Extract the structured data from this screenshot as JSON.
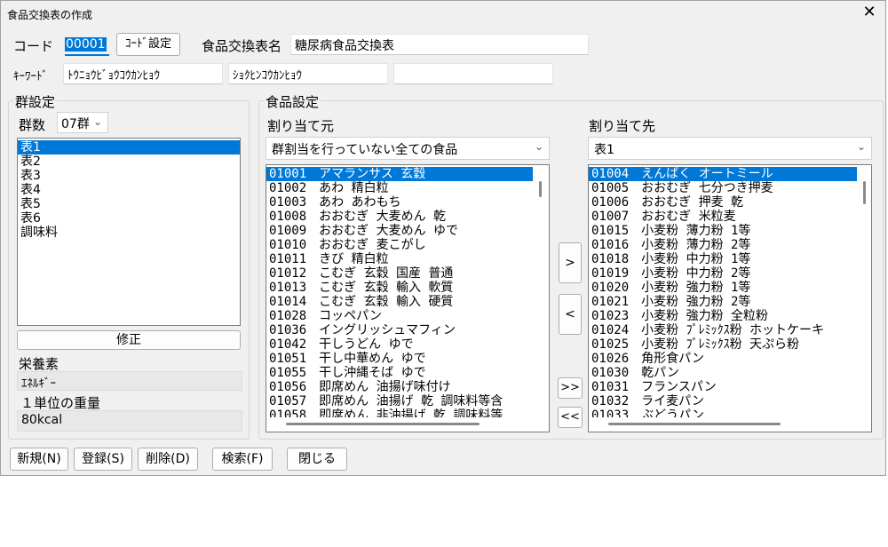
{
  "window": {
    "title": "食品交換表の作成",
    "close_glyph": "✕"
  },
  "header": {
    "code_label": "コード",
    "code_value": "00001",
    "code_settings_button": "ｺｰﾄﾞ設定",
    "table_name_label": "食品交換表名",
    "table_name_value": "糖尿病食品交換表",
    "keyword_label": "ｷｰﾜｰﾄﾞ",
    "keyword1": "ﾄｳﾆｮｳﾋﾞｮｳｺｳｶﾝﾋｮｳ",
    "keyword2": "ｼｮｸﾋﾝｺｳｶﾝﾋｮｳ",
    "keyword3": ""
  },
  "group_settings": {
    "title": "群設定",
    "count_label": "群数",
    "count_value": "07群",
    "groups": [
      "表1",
      "表2",
      "表3",
      "表4",
      "表5",
      "表6",
      "調味料"
    ],
    "selected_index": 0,
    "modify_button": "修正",
    "nutrient_label": "栄養素",
    "nutrient_value": "ｴﾈﾙｷﾞｰ",
    "unit_label": "１単位の重量",
    "unit_value": "80kcal"
  },
  "food_settings": {
    "title": "食品設定",
    "source_label": "割り当て元",
    "source_filter": "群割当を行っていない全ての食品",
    "source_items": [
      "01001　アマランサス 玄穀",
      "01002　あわ 精白粒",
      "01003　あわ あわもち",
      "01008　おおむぎ 大麦めん 乾",
      "01009　おおむぎ 大麦めん ゆで",
      "01010　おおむぎ 麦こがし",
      "01011　きび 精白粒",
      "01012　こむぎ 玄穀 国産 普通",
      "01013　こむぎ 玄穀 輸入 軟質",
      "01014　こむぎ 玄穀 輸入 硬質",
      "01028　コッペパン",
      "01036　イングリッシュマフィン",
      "01042　干しうどん ゆで",
      "01051　干し中華めん ゆで",
      "01055　干し沖縄そば ゆで",
      "01056　即席めん 油揚げ味付け",
      "01057　即席めん 油揚げ 乾 調味料等含",
      "01058　即席めん 非油揚げ 乾 調味料等"
    ],
    "source_selected_index": 0,
    "target_label": "割り当て先",
    "target_group": "表1",
    "target_items": [
      "01004　えんばく オートミール",
      "01005　おおむぎ 七分つき押麦",
      "01006　おおむぎ 押麦 乾",
      "01007　おおむぎ 米粒麦",
      "01015　小麦粉 薄力粉 1等",
      "01016　小麦粉 薄力粉 2等",
      "01018　小麦粉 中力粉 1等",
      "01019　小麦粉 中力粉 2等",
      "01020　小麦粉 強力粉 1等",
      "01021　小麦粉 強力粉 2等",
      "01023　小麦粉 強力粉 全粒粉",
      "01024　小麦粉 ﾌﾟﾚﾐｯｸｽ粉 ホットケーキ",
      "01025　小麦粉 ﾌﾟﾚﾐｯｸｽ粉 天ぷら粉",
      "01026　角形食パン",
      "01030　乾パン",
      "01031　フランスパン",
      "01032　ライ麦パン",
      "01033　ぶどうパン"
    ],
    "target_selected_index": 0,
    "move_right": ">",
    "move_left": "<",
    "move_all_right": ">>",
    "move_all_left": "<<"
  },
  "footer": {
    "new_button": "新規(N)",
    "register_button": "登録(S)",
    "delete_button": "削除(D)",
    "search_button": "検索(F)",
    "close_button": "閉じる"
  }
}
